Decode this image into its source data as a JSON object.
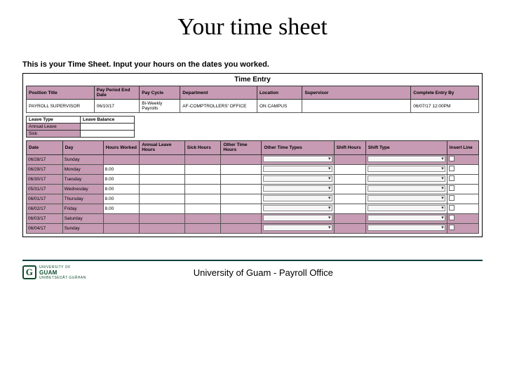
{
  "slide": {
    "title": "Your time sheet",
    "subtitle": "This is your Time Sheet. Input your hours on the dates you worked."
  },
  "screenshot": {
    "heading": "Time Entry",
    "info_headers": [
      "Position Title",
      "Pay Period End Date",
      "Pay Cycle",
      "Department",
      "Location",
      "Supervisor",
      "Complete Entry By"
    ],
    "info_values": [
      "PAYROLL SUPERVISOR",
      "06/10/17",
      "Bi-Weekly Payrolls",
      "AF-COMPTROLLERS' OFFICE",
      "ON CAMPUS",
      "",
      "06/07/17 12:00PM"
    ],
    "leave": {
      "headers": [
        "Leave Type",
        "Leave Balance"
      ],
      "rows": [
        [
          "Annual Leave",
          ""
        ],
        [
          "Sick",
          ""
        ]
      ]
    },
    "grid_headers": [
      "Date",
      "Day",
      "Hours Worked",
      "Annual Leave Hours",
      "Sick Hours",
      "Other Time Hours",
      "Other Time Types",
      "Shift Hours",
      "Shift Type",
      "Insert Line"
    ],
    "grid_rows": [
      {
        "date": "06/28/17",
        "day": "Sunday",
        "hours": "",
        "alt": true
      },
      {
        "date": "06/29/17",
        "day": "Monday",
        "hours": "8.00"
      },
      {
        "date": "06/30/17",
        "day": "Tuesday",
        "hours": "8.00"
      },
      {
        "date": "05/31/17",
        "day": "Wednesday",
        "hours": "8.00"
      },
      {
        "date": "06/01/17",
        "day": "Thursday",
        "hours": "8.00"
      },
      {
        "date": "06/02/17",
        "day": "Friday",
        "hours": "8.00"
      },
      {
        "date": "06/03/17",
        "day": "Saturday",
        "hours": "",
        "alt": true
      },
      {
        "date": "06/04/17",
        "day": "Sunday",
        "hours": "",
        "alt": true
      }
    ]
  },
  "footer": {
    "logo_top": "UNIVERSITY OF",
    "logo_main": "GUAM",
    "logo_sub": "UNIBETSEDÅT GUÅHAN",
    "text": "University of Guam - Payroll Office"
  }
}
